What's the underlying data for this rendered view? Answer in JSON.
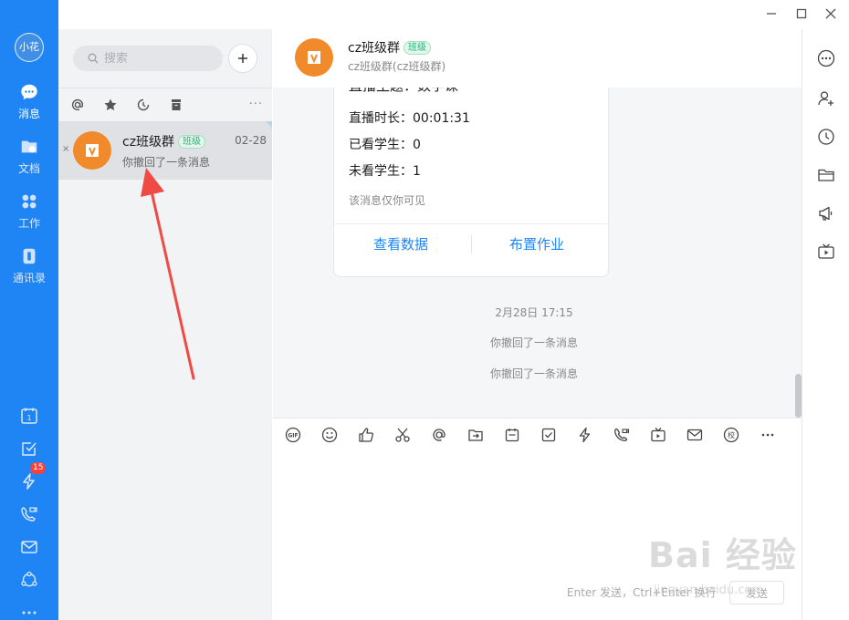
{
  "app": {
    "user_avatar_text": "小花",
    "colors": {
      "accent": "#1f85f5",
      "rail_bg": "#1f85f5",
      "badge": "#f5423b",
      "group_avatar": "#f08a2a",
      "annotation_arrow": "#f04a45"
    }
  },
  "rail": {
    "items": [
      {
        "label": "消息",
        "icon": "chat-bubble-icon",
        "active": true
      },
      {
        "label": "文档",
        "icon": "folder-icon",
        "active": false
      },
      {
        "label": "工作",
        "icon": "apps-grid-icon",
        "active": false
      },
      {
        "label": "通讯录",
        "icon": "contacts-book-icon",
        "active": false
      }
    ],
    "bottom": [
      {
        "icon": "calendar-icon",
        "text": "1"
      },
      {
        "icon": "checkbox-icon"
      },
      {
        "icon": "lightning-icon",
        "badge": "15"
      },
      {
        "icon": "video-call-icon"
      },
      {
        "icon": "mail-icon"
      },
      {
        "icon": "network-icon"
      },
      {
        "icon": "more-dots-icon"
      }
    ]
  },
  "conversation_list": {
    "search_placeholder": "搜索",
    "filter_more": "···",
    "items": [
      {
        "name": "cz班级群",
        "tag": "班级",
        "time": "02-28",
        "preview": "你撤回了一条消息",
        "close": "×"
      }
    ]
  },
  "chat": {
    "title": "cz班级群",
    "tag": "班级",
    "subtitle": "cz班级群(cz班级群)",
    "card": {
      "topic": "直播主题：数学课",
      "duration": "直播时长：00:01:31",
      "watched": "已看学生：0",
      "unwatched": "未看学生：1",
      "note": "该消息仅你可见",
      "button_view": "查看数据",
      "button_assign": "布置作业"
    },
    "system_messages": [
      "2月28日 17:15",
      "你撤回了一条消息",
      "你撤回了一条消息"
    ]
  },
  "composer": {
    "gif_label": "GIF",
    "school_label": "校",
    "send_hint": "Enter 发送，Ctrl+Enter 换行",
    "send_label": "发送"
  },
  "watermark": {
    "text": "Bai 经验",
    "sub": "jingyan.baidu.com"
  }
}
